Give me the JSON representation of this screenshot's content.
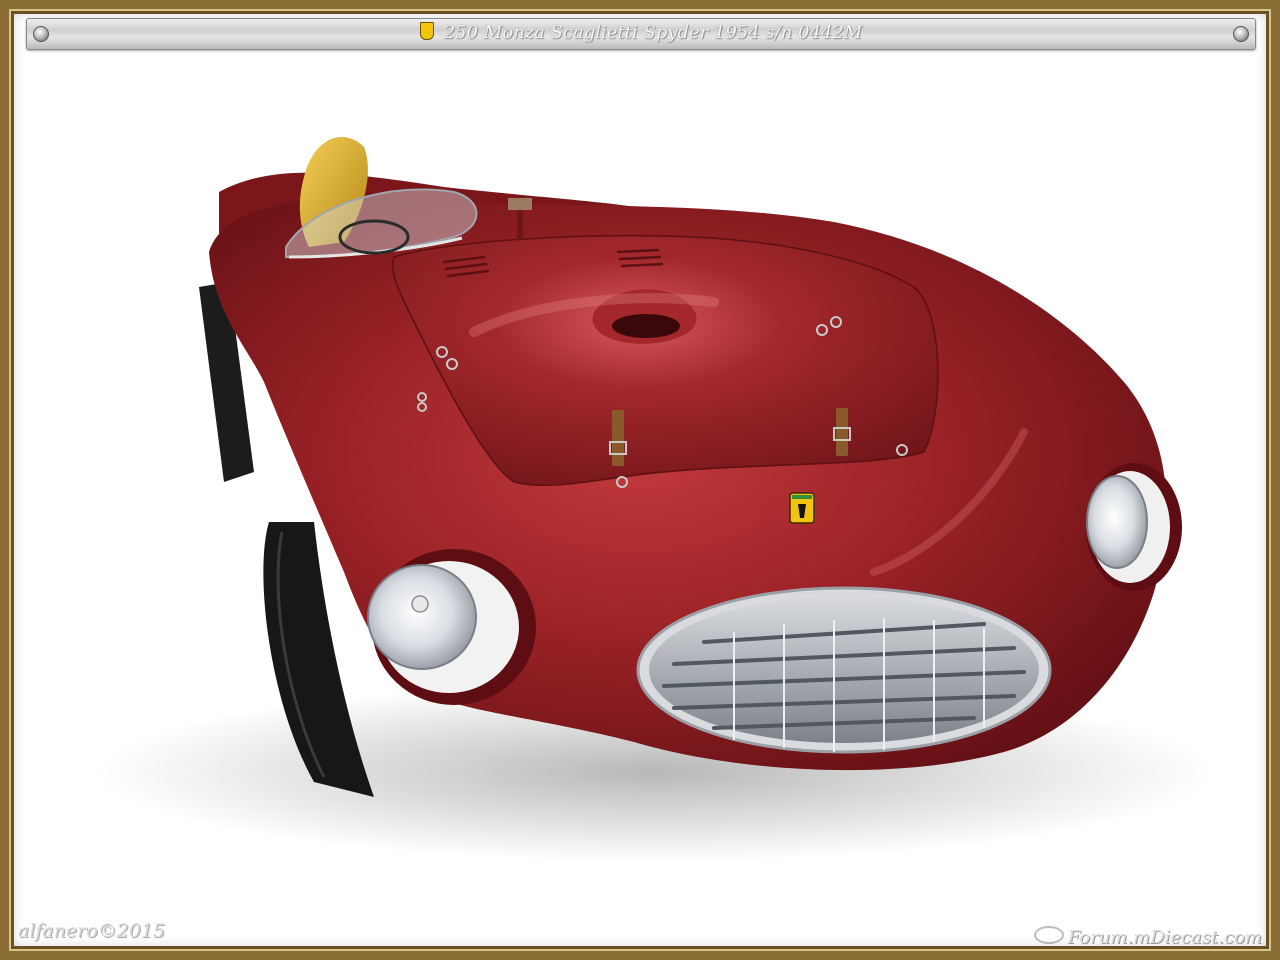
{
  "title": "250 Monza Scaglietti Spyder 1954  s/n 0442M",
  "signature": "alfanero©2015",
  "watermark": "Forum.mDiecast.com",
  "colors": {
    "body_red": "#8e1f22",
    "body_highlight": "#c74346",
    "seat_yellow": "#e8b834",
    "frame_gold": "#8a6e36"
  }
}
